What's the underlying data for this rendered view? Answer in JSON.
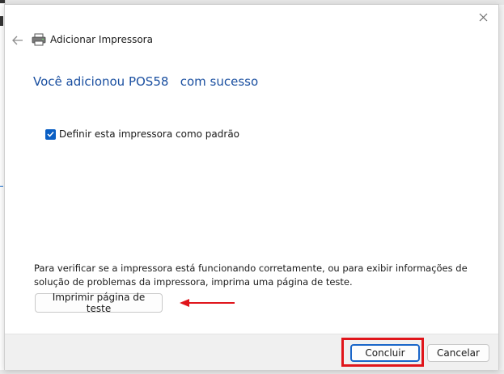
{
  "dialog": {
    "title": "Adicionar Impressora",
    "heading": "Você adicionou POS58   com sucesso",
    "default_checkbox": {
      "label": "Definir esta impressora como padrão",
      "checked": true
    },
    "info_text": "Para verificar se a impressora está funcionando corretamente, ou para exibir informações de solução de problemas da impressora, imprima uma página de teste.",
    "test_button": "Imprimir página de teste",
    "finish_button": "Concluir",
    "cancel_button": "Cancelar"
  },
  "icons": {
    "close": "close-icon",
    "back": "back-arrow-icon",
    "printer": "printer-icon",
    "check": "check-icon"
  },
  "colors": {
    "accent": "#0a5fc4",
    "heading": "#1a4fa0",
    "annotation": "#e0151b"
  }
}
